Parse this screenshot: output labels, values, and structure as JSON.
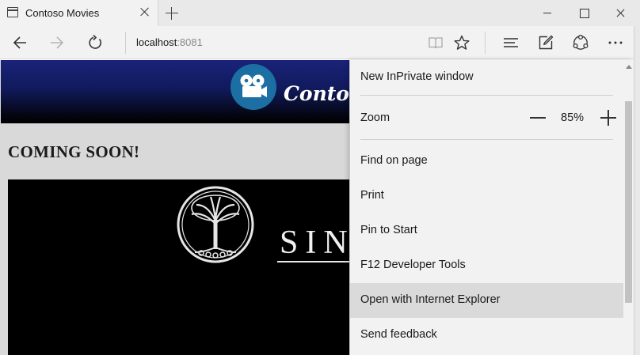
{
  "browser": {
    "tab_title": "Contoso Movies",
    "address_host": "localhost",
    "address_port": ":8081"
  },
  "icons": {
    "tab_favicon": "page-icon",
    "tab_close": "close-icon",
    "new_tab": "plus-icon",
    "back": "arrow-left-icon",
    "forward": "arrow-right-icon",
    "refresh": "refresh-icon",
    "reading_view": "book-icon",
    "favorites": "star-icon",
    "hub": "hub-icon",
    "web_note": "pen-note-icon",
    "share": "share-icon",
    "more": "ellipsis-icon"
  },
  "page": {
    "logo_text": "Contoso",
    "coming_soon": "COMING SOON!",
    "trailer_title": "SIN"
  },
  "menu": {
    "items_top": [
      {
        "label": "New InPrivate window"
      }
    ],
    "zoom": {
      "label": "Zoom",
      "value": "85%"
    },
    "items_bottom": [
      {
        "label": "Find on page"
      },
      {
        "label": "Print"
      },
      {
        "label": "Pin to Start"
      },
      {
        "label": "F12 Developer Tools"
      },
      {
        "label": "Open with Internet Explorer",
        "highlighted": true
      },
      {
        "label": "Send feedback"
      }
    ]
  },
  "colors": {
    "chrome_bg": "#f2f2f2",
    "header_blue": "#1a237a",
    "logo_blue": "#1c6fa3",
    "menu_highlight": "#dadada"
  }
}
